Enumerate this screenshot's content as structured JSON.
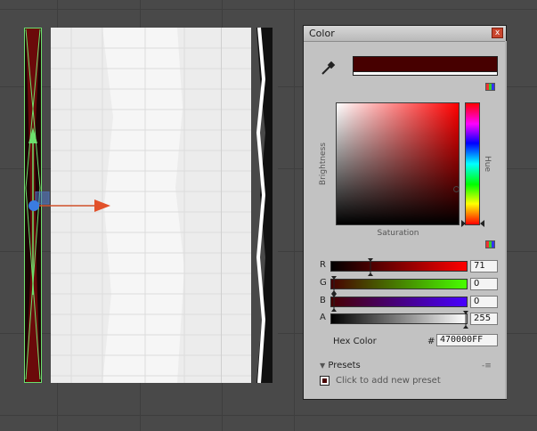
{
  "window": {
    "title": "Color",
    "close_glyph": "x"
  },
  "current_color": "#470000",
  "picker": {
    "brightness_label": "Brightness",
    "hue_label": "Hue",
    "saturation_label": "Saturation",
    "hue_color": "#ff0000"
  },
  "channels": [
    {
      "label": "R",
      "value": "71",
      "fraction": 0.278,
      "from": "#000000",
      "to": "#ff0000"
    },
    {
      "label": "G",
      "value": "0",
      "fraction": 0.0,
      "from": "#470000",
      "to": "#47ff00"
    },
    {
      "label": "B",
      "value": "0",
      "fraction": 0.0,
      "from": "#470000",
      "to": "#4700ff"
    },
    {
      "label": "A",
      "value": "255",
      "fraction": 1.0,
      "from": "#000000",
      "to": "#ffffff"
    }
  ],
  "hex": {
    "label": "Hex Color",
    "hash": "#",
    "value": "470000FF"
  },
  "presets": {
    "header": "Presets",
    "collapse_glyph": "▼",
    "menu_glyph": "-≡",
    "add_label": "Click to add new preset"
  },
  "icons": {
    "eyedropper": "eyedropper-icon",
    "mode_toggle": "color-mode-icon",
    "slider_mode": "slider-mode-icon",
    "close": "close-icon"
  }
}
